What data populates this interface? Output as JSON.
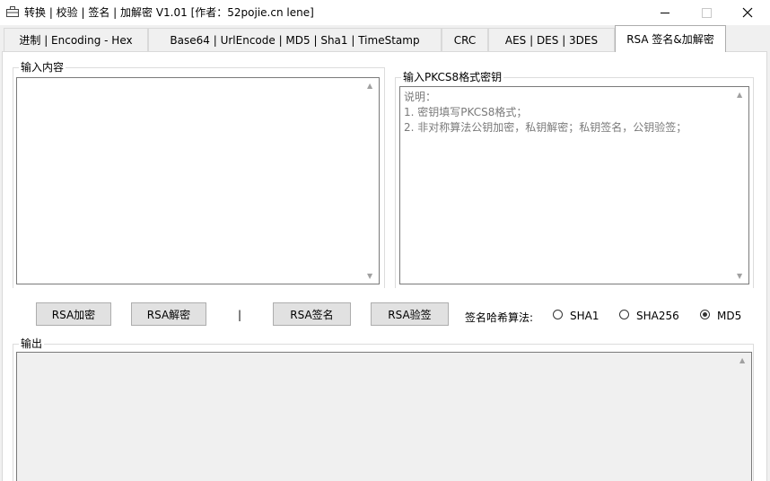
{
  "window": {
    "title": "转换 | 校验 | 签名 | 加解密 V1.01    [作者：52pojie.cn lene]"
  },
  "tabs": [
    {
      "label": "进制 | Encoding - Hex"
    },
    {
      "label": "Base64 | UrlEncode | MD5 | Sha1 | TimeStamp"
    },
    {
      "label": "CRC"
    },
    {
      "label": "AES | DES | 3DES"
    },
    {
      "label": "RSA 签名&加解密"
    }
  ],
  "input_group": {
    "label": "输入内容",
    "value": ""
  },
  "key_group": {
    "label": "输入PKCS8格式密钥",
    "placeholder": "说明：\n1. 密钥填写PKCS8格式；\n2. 非对称算法公钥加密，私钥解密；私钥签名，公钥验签；"
  },
  "actions": {
    "encrypt": "RSA加密",
    "decrypt": "RSA解密",
    "separator": "|",
    "sign": "RSA签名",
    "verify": "RSA验签"
  },
  "hash": {
    "label": "签名哈希算法:",
    "options": [
      "SHA1",
      "SHA256",
      "MD5"
    ],
    "selected": "MD5"
  },
  "output_group": {
    "label": "输出",
    "value": ""
  }
}
